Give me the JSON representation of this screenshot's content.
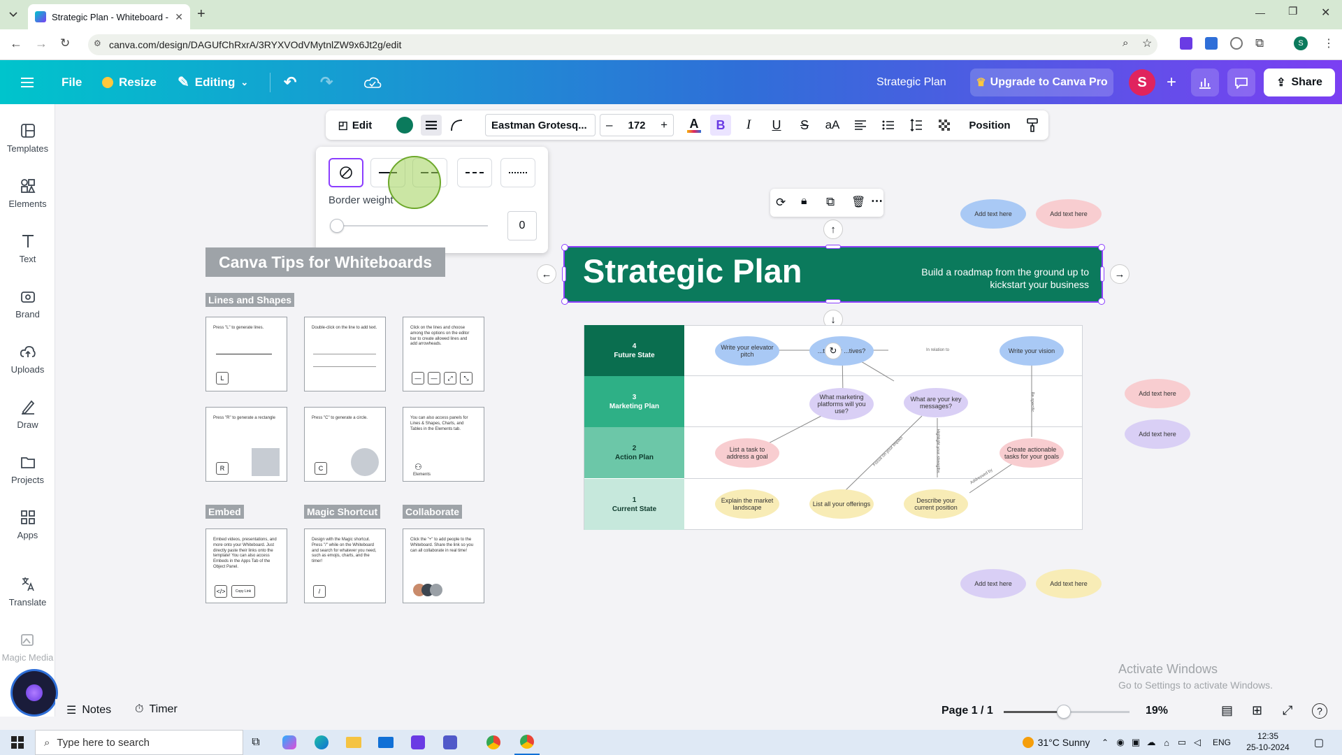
{
  "browser": {
    "tab_title": "Strategic Plan - Whiteboard - C",
    "url": "canva.com/design/DAGUfChRxrA/3RYXVOdVMytnlZW9x6Jt2g/edit"
  },
  "header": {
    "file": "File",
    "resize": "Resize",
    "editing": "Editing",
    "doc_title": "Strategic Plan",
    "upgrade": "Upgrade to Canva Pro",
    "avatar": "S",
    "share": "Share"
  },
  "sidebar": [
    {
      "label": "Templates",
      "icon": "templates-icon"
    },
    {
      "label": "Elements",
      "icon": "elements-icon"
    },
    {
      "label": "Text",
      "icon": "text-icon"
    },
    {
      "label": "Brand",
      "icon": "brand-icon"
    },
    {
      "label": "Uploads",
      "icon": "uploads-icon"
    },
    {
      "label": "Draw",
      "icon": "draw-icon"
    },
    {
      "label": "Projects",
      "icon": "projects-icon"
    },
    {
      "label": "Apps",
      "icon": "apps-icon"
    },
    {
      "label": "Translate",
      "icon": "translate-icon"
    },
    {
      "label": "Magic Media",
      "icon": "magic-media-icon"
    }
  ],
  "toolbar": {
    "edit": "Edit",
    "fill_color": "#0b7a5c",
    "font": "Eastman Grotesq...",
    "minus": "–",
    "font_size": "172",
    "plus": "+",
    "position": "Position"
  },
  "border_popup": {
    "label": "Border weight",
    "value": "0"
  },
  "tips": {
    "title": "Canva Tips for Whiteboards",
    "lines_shapes": "Lines and Shapes",
    "embed": "Embed",
    "magic_shortcut": "Magic Shortcut",
    "collaborate": "Collaborate",
    "card1": "Press \"L\" to generate lines.",
    "card2a": "Double-click on the line to add text.",
    "card3": "Click on the lines and choose among the options on the editor bar to create allowed lines and add arrowheads.",
    "card4": "Press \"R\" to generate a rectangle",
    "card5": "Press \"C\" to generate a circle.",
    "card6": "You can also access panels for Lines & Shapes, Charts, and Tables in the Elements tab.",
    "card6b": "Elements",
    "card7": "Embed videos, presentations, and more onto your Whiteboard. Just directly paste their links onto the template! You can also access Embeds in the Apps Tab of the Object Panel.",
    "card7b": "Copy Link",
    "card8": "Design with the Magic shortcut. Press \"/\" while on the Whiteboard and search for whatever you need, such as emojis, charts, and the timer!",
    "card9": "Click the \"+\" to add people to the Whiteboard. Share the link so you can all collaborate in real time!",
    "key_l": "L",
    "key_r": "R",
    "key_c": "C",
    "key_slash": "/",
    "key_embed": "</>"
  },
  "plan": {
    "title": "Strategic Plan",
    "subtitle": "Build a roadmap from the ground up to kickstart your business",
    "rows": [
      {
        "num": "4",
        "name": "Future State",
        "color": "#0a6e4f"
      },
      {
        "num": "3",
        "name": "Marketing Plan",
        "color": "#2eb086"
      },
      {
        "num": "2",
        "name": "Action Plan",
        "color": "#6cc7a8"
      },
      {
        "num": "1",
        "name": "Current State",
        "color": "#c6e8dc"
      }
    ],
    "bubbles": {
      "elevator": "Write your elevator pitch",
      "objectives": "...te your ...tives?",
      "vision": "Write your vision",
      "platforms": "What marketing platforms will you use?",
      "messages": "What are your key messages?",
      "task": "List a task to address a goal",
      "actionable": "Create actionable tasks for your goals",
      "landscape": "Explain the market landscape",
      "offerings": "List all your offerings",
      "position": "Describe your current position"
    },
    "connectors": {
      "in_relation": "In relation to",
      "be_specific": "Be specific",
      "focus_impact": "Focus on your impact",
      "highlight": "Highlight your strengths",
      "addressed_by": "Addressed by"
    },
    "extra": "Add text here"
  },
  "watermark": {
    "line1": "Activate Windows",
    "line2": "Go to Settings to activate Windows."
  },
  "bottom": {
    "notes": "Notes",
    "timer": "Timer",
    "page": "Page 1 / 1",
    "zoom_pct": "19%",
    "zoom_fraction": 0.48
  },
  "taskbar": {
    "search": "Type here to search",
    "weather": "31°C  Sunny",
    "lang": "ENG",
    "time": "12:35",
    "date": "25-10-2024"
  },
  "colors": {
    "brand_green": "#0b7a5c",
    "selection": "#8b3dff"
  }
}
